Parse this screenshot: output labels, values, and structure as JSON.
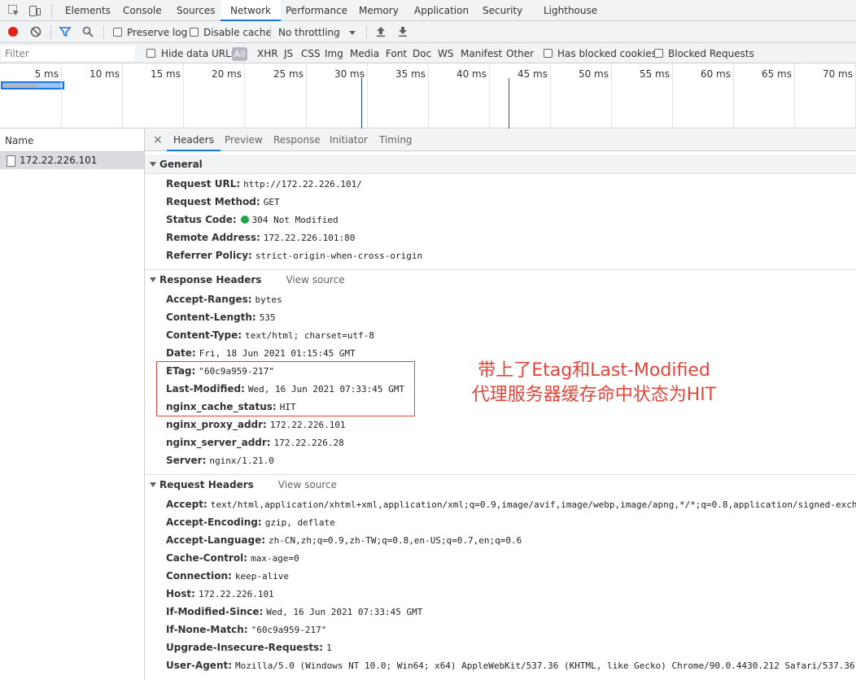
{
  "devtools": {
    "tabs": [
      {
        "label": "Elements"
      },
      {
        "label": "Console"
      },
      {
        "label": "Sources"
      },
      {
        "label": "Network"
      },
      {
        "label": "Performance"
      },
      {
        "label": "Memory"
      },
      {
        "label": "Application"
      },
      {
        "label": "Security"
      },
      {
        "label": "Lighthouse"
      }
    ],
    "active_tab": "Network"
  },
  "toolbar": {
    "preserve_log": "Preserve log",
    "disable_cache": "Disable cache",
    "throttling": "No throttling"
  },
  "filterbar": {
    "placeholder": "Filter",
    "hide_data_urls": "Hide data URLs",
    "all": "All",
    "types": [
      "XHR",
      "JS",
      "CSS",
      "Img",
      "Media",
      "Font",
      "Doc",
      "WS",
      "Manifest",
      "Other"
    ],
    "has_blocked_cookies": "Has blocked cookies",
    "blocked_requests": "Blocked Requests"
  },
  "timeline": {
    "ticks": [
      "5 ms",
      "10 ms",
      "15 ms",
      "20 ms",
      "25 ms",
      "30 ms",
      "35 ms",
      "40 ms",
      "45 ms",
      "50 ms",
      "55 ms",
      "60 ms",
      "65 ms",
      "70 ms"
    ],
    "colors": {
      "dom_content_loaded": "#1a3fcf",
      "load": "#b02121",
      "bar": "#1a73e8"
    }
  },
  "request_list": {
    "header": "Name",
    "items": [
      {
        "name": "172.22.226.101"
      }
    ]
  },
  "detail": {
    "close": "×",
    "tabs": [
      "Headers",
      "Preview",
      "Response",
      "Initiator",
      "Timing"
    ],
    "active_tab": "Headers",
    "view_source": "View source",
    "general": {
      "title": "General",
      "rows": [
        {
          "k": "Request URL:",
          "v": "http://172.22.226.101/"
        },
        {
          "k": "Request Method:",
          "v": "GET"
        },
        {
          "k": "Status Code:",
          "v": "304 Not Modified",
          "status_color": "#1ea446"
        },
        {
          "k": "Remote Address:",
          "v": "172.22.226.101:80"
        },
        {
          "k": "Referrer Policy:",
          "v": "strict-origin-when-cross-origin"
        }
      ]
    },
    "response_headers": {
      "title": "Response Headers",
      "rows": [
        {
          "k": "Accept-Ranges:",
          "v": "bytes"
        },
        {
          "k": "Content-Length:",
          "v": "535"
        },
        {
          "k": "Content-Type:",
          "v": "text/html; charset=utf-8"
        },
        {
          "k": "Date:",
          "v": "Fri, 18 Jun 2021 01:15:45 GMT"
        },
        {
          "k": "ETag:",
          "v": "\"60c9a959-217\""
        },
        {
          "k": "Last-Modified:",
          "v": "Wed, 16 Jun 2021 07:33:45 GMT"
        },
        {
          "k": "nginx_cache_status:",
          "v": "HIT"
        },
        {
          "k": "nginx_proxy_addr:",
          "v": "172.22.226.101"
        },
        {
          "k": "nginx_server_addr:",
          "v": "172.22.226.28"
        },
        {
          "k": "Server:",
          "v": "nginx/1.21.0"
        }
      ]
    },
    "request_headers": {
      "title": "Request Headers",
      "rows": [
        {
          "k": "Accept:",
          "v": "text/html,application/xhtml+xml,application/xml;q=0.9,image/avif,image/webp,image/apng,*/*;q=0.8,application/signed-exchan"
        },
        {
          "k": "Accept-Encoding:",
          "v": "gzip, deflate"
        },
        {
          "k": "Accept-Language:",
          "v": "zh-CN,zh;q=0.9,zh-TW;q=0.8,en-US;q=0.7,en;q=0.6"
        },
        {
          "k": "Cache-Control:",
          "v": "max-age=0"
        },
        {
          "k": "Connection:",
          "v": "keep-alive"
        },
        {
          "k": "Host:",
          "v": "172.22.226.101"
        },
        {
          "k": "If-Modified-Since:",
          "v": "Wed, 16 Jun 2021 07:33:45 GMT"
        },
        {
          "k": "If-None-Match:",
          "v": "\"60c9a959-217\""
        },
        {
          "k": "Upgrade-Insecure-Requests:",
          "v": "1"
        },
        {
          "k": "User-Agent:",
          "v": "Mozilla/5.0 (Windows NT 10.0; Win64; x64) AppleWebKit/537.36 (KHTML, like Gecko) Chrome/90.0.4430.212 Safari/537.36"
        }
      ]
    }
  },
  "annotation": {
    "line1": "带上了Etag和Last-Modified",
    "line2": "代理服务器缓存命中状态为HIT",
    "color": "#e0453a"
  }
}
